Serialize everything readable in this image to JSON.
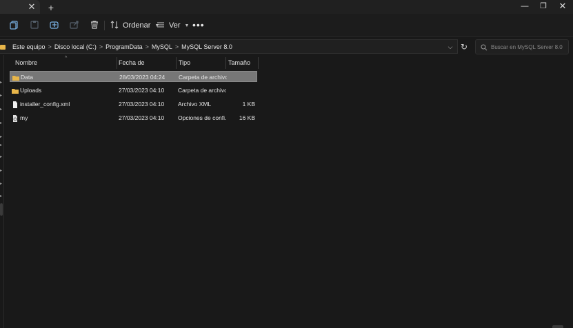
{
  "tab": {
    "close_glyph": "✕",
    "add_glyph": "+"
  },
  "window": {
    "minimize": "—",
    "maximize": "❐",
    "close": "✕"
  },
  "toolbar": {
    "icons": [
      "new-icon",
      "cut-icon",
      "copy-icon",
      "paste-icon",
      "share-icon",
      "delete-icon"
    ],
    "sort_label": "Ordenar",
    "view_label": "Ver",
    "more_label": "•••"
  },
  "address": {
    "crumbs": [
      "Este equipo",
      "Disco local (C:)",
      "ProgramData",
      "MySQL",
      "MySQL Server 8.0"
    ],
    "separator": ">",
    "dropdown": "⌵",
    "refresh": "↻"
  },
  "search": {
    "placeholder": "Buscar en MySQL Server 8.0"
  },
  "columns": {
    "name": "Nombre",
    "date": "Fecha de modificación",
    "type": "Tipo",
    "size": "Tamaño",
    "sort_caret": "^"
  },
  "files": [
    {
      "name": "Data",
      "date": "28/03/2023 04:24",
      "type": "Carpeta de archivos",
      "size": "",
      "icon": "folder-icon",
      "selected": true
    },
    {
      "name": "Uploads",
      "date": "27/03/2023 04:10",
      "type": "Carpeta de archivos",
      "size": "",
      "icon": "folder-icon",
      "selected": false
    },
    {
      "name": "installer_config.xml",
      "date": "27/03/2023 04:10",
      "type": "Archivo XML",
      "size": "1 KB",
      "icon": "file-icon",
      "selected": false
    },
    {
      "name": "my",
      "date": "27/03/2023 04:10",
      "type": "Opciones de confi...",
      "size": "16 KB",
      "icon": "config-file-icon",
      "selected": false
    }
  ],
  "colors": {
    "background": "#191919",
    "selected_row": "#777777",
    "folder": "#e8b64a"
  }
}
